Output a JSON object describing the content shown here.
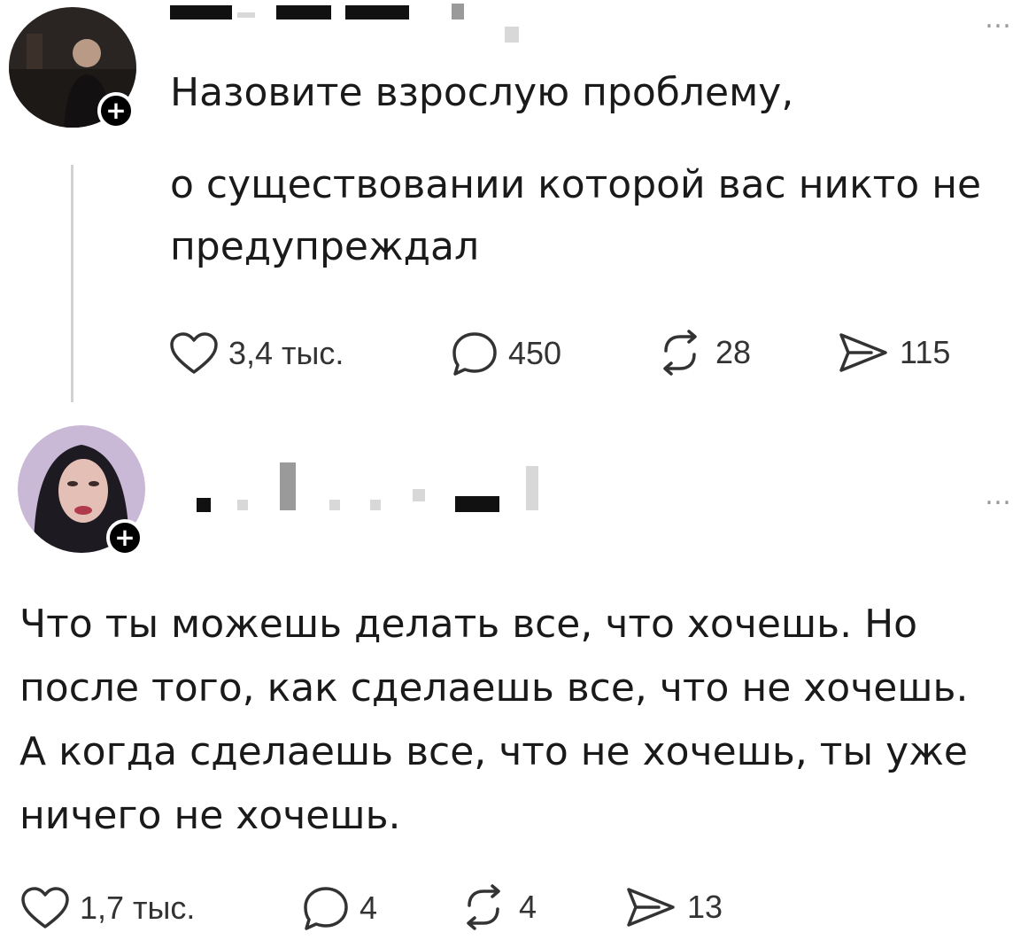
{
  "posts": [
    {
      "text_lines": [
        "Назовите взрослую проблему,",
        "о существовании которой вас никто не",
        "предупреждал"
      ],
      "more_label": "…",
      "follow_label": "+",
      "actions": {
        "likes": "3,4 тыс.",
        "comments": "450",
        "reposts": "28",
        "shares": "115"
      }
    },
    {
      "text_lines": [
        "Что ты можешь делать все, что хочешь. Но",
        "после того, как сделаешь все, что не хочешь.",
        "А когда сделаешь все, что не хочешь, ты уже",
        "ничего не хочешь."
      ],
      "more_label": "…",
      "follow_label": "+",
      "actions": {
        "likes": "1,7 тыс.",
        "comments": "4",
        "reposts": "4",
        "shares": "13"
      }
    }
  ],
  "icons": {
    "like": "heart-icon",
    "comment": "comment-bubble-icon",
    "repost": "repost-icon",
    "share": "share-icon",
    "more": "more-dots-icon",
    "follow": "plus-icon"
  },
  "colors": {
    "text": "#1a1a1a",
    "muted": "#9a9a9a",
    "thread_line": "#d2d2d2",
    "badge": "#000000"
  }
}
